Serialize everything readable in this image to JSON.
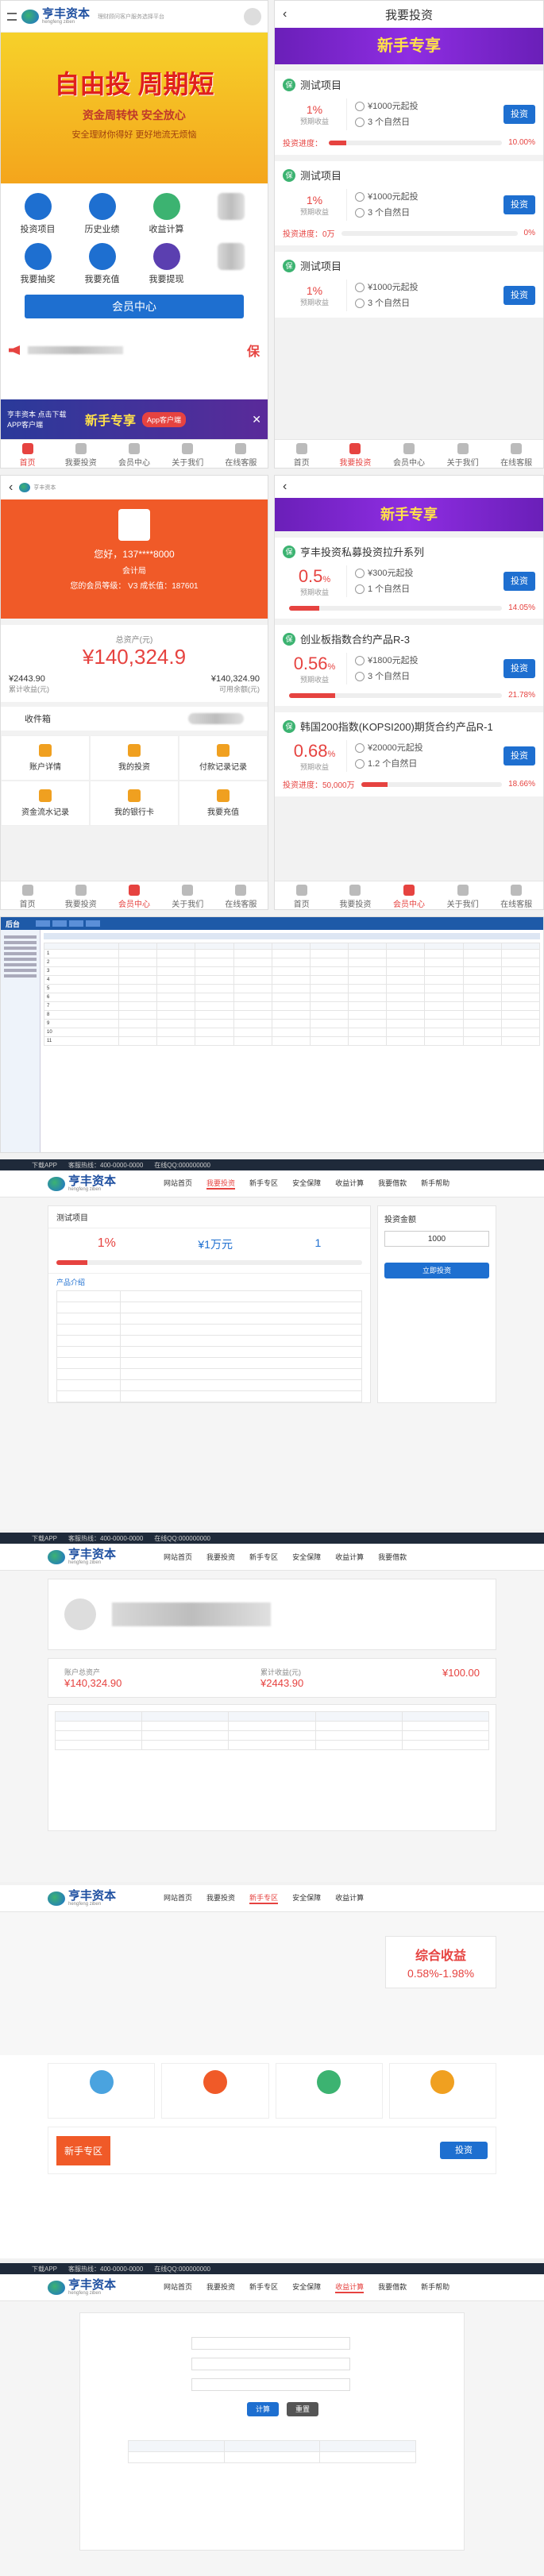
{
  "home": {
    "logo_name": "亨丰资本",
    "logo_sub": "hengfeng ziben",
    "logo_tag": "理财顾问客户服务选择平台",
    "banner_title": "自由投 周期短",
    "banner_line2": "资金周转快 安全放心",
    "banner_line3": "安全理财你得好 更好地流无烦恼",
    "icons": [
      {
        "label": "投资项目",
        "color": "#1e6fd0"
      },
      {
        "label": "历史业绩",
        "color": "#1e6fd0"
      },
      {
        "label": "收益计算",
        "color": "#3cb371"
      },
      {
        "label": "",
        "color": "#ccc"
      },
      {
        "label": "我要抽奖",
        "color": "#1e6fd0"
      },
      {
        "label": "我要充值",
        "color": "#1e6fd0"
      },
      {
        "label": "我要提现",
        "color": "#5b3fb0"
      },
      {
        "label": "",
        "color": "#ccc"
      }
    ],
    "member_button": "会员中心",
    "promo_text": "亨丰资本 点击下载APP客户端",
    "promo_badge": "新手专享",
    "promo_btn": "App客户端",
    "safe_mark": "保",
    "tabs": [
      "首页",
      "我要投资",
      "会员中心",
      "关于我们",
      "在线客服"
    ]
  },
  "invest": {
    "title": "我要投资",
    "banner": "新手专享",
    "items": [
      {
        "name": "测试项目",
        "rate": "1%",
        "rate_lbl": "预期收益",
        "min": "¥1000元起投",
        "period": "3 个自然日",
        "btn": "投资",
        "progress_lbl": "投资进度：",
        "progress": "10.00%",
        "pct": 10
      },
      {
        "name": "测试项目",
        "rate": "1%",
        "rate_lbl": "预期收益",
        "min": "¥1000元起投",
        "period": "3 个自然日",
        "btn": "投资",
        "progress_lbl": "投资进度：0万",
        "progress": "0%",
        "pct": 0
      },
      {
        "name": "测试项目",
        "rate": "1%",
        "rate_lbl": "预期收益",
        "min": "¥1000元起投",
        "period": "3 个自然日",
        "btn": "投资",
        "progress_lbl": "",
        "progress": "",
        "pct": 0
      }
    ],
    "tabs": [
      "首页",
      "我要投资",
      "会员中心",
      "关于我们",
      "在线客服"
    ]
  },
  "member": {
    "user": "您好，137****8000",
    "level_lbl": "会计局",
    "vip": "您的会员等级：  V3  成长值：187601",
    "asset_lbl": "总资产(元)",
    "asset": "¥140,324.9",
    "left_val": "¥2443.90",
    "left_lbl": "累计收益(元)",
    "right_val": "¥140,324.90",
    "right_lbl": "可用余额(元)",
    "tab_left": "收件箱",
    "grid": [
      "账户详情",
      "我的投资",
      "付款记录记录",
      "资金流水记录",
      "我的银行卡",
      "我要充值"
    ],
    "tabs": [
      "首页",
      "我要投资",
      "会员中心",
      "关于我们",
      "在线客服"
    ]
  },
  "series": {
    "banner": "新手专享",
    "items": [
      {
        "name": "亨丰投资私募投资拉升系列",
        "rate": "0.5",
        "unit": "%",
        "rate_lbl": "预期收益",
        "min": "¥300元起投",
        "period": "1 个自然日",
        "btn": "投资",
        "progress": "14.05%",
        "pct": 14.05
      },
      {
        "name": "创业板指数合约产品R-3",
        "rate": "0.56",
        "unit": "%",
        "rate_lbl": "预期收益",
        "min": "¥1800元起投",
        "period": "3 个自然日",
        "btn": "投资",
        "progress": "21.78%",
        "pct": 21.78
      },
      {
        "name": "韩国200指数(KOPSI200)期货合约产品R-1",
        "rate": "0.68",
        "unit": "%",
        "rate_lbl": "预期收益",
        "min": "¥20000元起投",
        "period": "1.2 个自然日",
        "btn": "投资",
        "progress_lbl": "投资进度：50,000万",
        "progress": "18.66%",
        "pct": 18.66
      }
    ],
    "tabs": [
      "首页",
      "我要投资",
      "会员中心",
      "关于我们",
      "在线客服"
    ]
  },
  "admin": {
    "brand": "后台",
    "rows": [
      "1",
      "2",
      "3",
      "4",
      "5",
      "6",
      "7",
      "8",
      "9",
      "10",
      "11"
    ]
  },
  "web": {
    "top_left": "下载APP",
    "top_phone": "客服热线：400-0000-0000",
    "top_qq": "在线QQ:000000000",
    "nav": [
      "网站首页",
      "我要投资",
      "新手专区",
      "安全保障",
      "收益计算",
      "我要借款",
      "新手帮助"
    ],
    "detail_title": "测试项目",
    "detail_rate": "1%",
    "detail_amount": "¥1万元",
    "detail_period": "1",
    "detail_section": "产品介绍",
    "invest_box": "投资金额",
    "invest_input": "1000",
    "invest_btn": "立即投资",
    "acct_asset_lbl": "账户总资产",
    "acct_asset": "¥140,324.90",
    "acct_income": "累计收益(元)",
    "acct_income_val": "¥2443.90",
    "acct_avail": "¥100.00",
    "calc_title": "综合收益",
    "calc_range": "0.58%-1.98%",
    "newbie": "新手专区",
    "calc_btn": "计算",
    "calc_reset": "重置"
  }
}
